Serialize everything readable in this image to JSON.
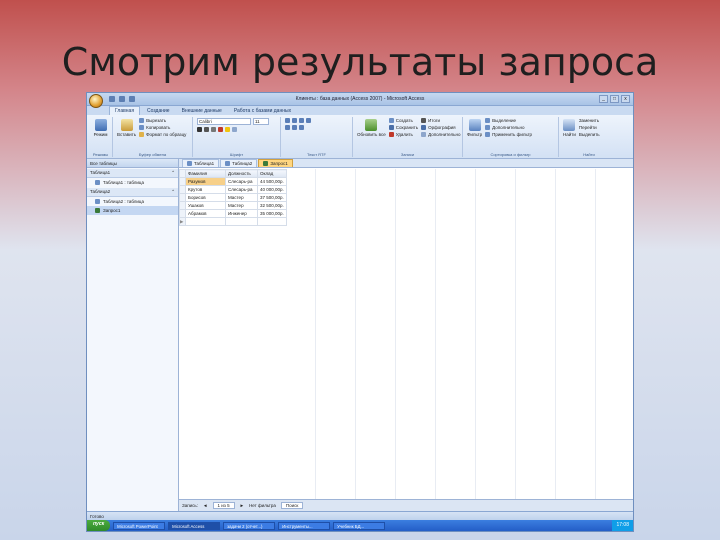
{
  "slide": {
    "title": "Смотрим результаты запроса"
  },
  "window": {
    "title": "Клиенты : база данных (Access 2007) - Microsoft Access",
    "controls": [
      "_",
      "□",
      "x"
    ]
  },
  "ribbon": {
    "tabs": [
      "Главная",
      "Создание",
      "Внешние данные",
      "Работа с базами данных"
    ],
    "active_tab": 0,
    "groups": [
      {
        "caption": "Режимы",
        "items": [
          "Режим"
        ]
      },
      {
        "caption": "Буфер обмена",
        "items": [
          "Вставить",
          "Вырезать",
          "Копировать",
          "Формат по образцу"
        ]
      },
      {
        "caption": "Шрифт",
        "items": [
          "Calibri",
          "11"
        ]
      },
      {
        "caption": "Текст RTF",
        "items": []
      },
      {
        "caption": "Записи",
        "items": [
          "Обновить все",
          "Создать",
          "Сохранить",
          "Удалить",
          "Итоги",
          "Орфография",
          "Дополнительно"
        ]
      },
      {
        "caption": "Сортировка и фильтр",
        "items": [
          "Фильтр",
          "Выделение",
          "Дополнительно",
          "Применить фильтр"
        ]
      },
      {
        "caption": "Найти",
        "items": [
          "Найти",
          "Заменить",
          "Перейти",
          "Выделить"
        ]
      }
    ]
  },
  "nav": {
    "header": "Все таблицы",
    "groups": [
      {
        "name": "Таблица1",
        "items": [
          {
            "label": "Таблица1 : таблица",
            "selected": false
          }
        ]
      },
      {
        "name": "Таблица2",
        "items": [
          {
            "label": "Таблица2 : таблица",
            "selected": false
          },
          {
            "label": "Запрос1",
            "selected": true
          }
        ]
      }
    ]
  },
  "doc_tabs": [
    {
      "label": "Таблица1",
      "active": false
    },
    {
      "label": "Таблица2",
      "active": false
    },
    {
      "label": "Запрос1",
      "active": true
    }
  ],
  "table": {
    "columns": [
      "Фамилия",
      "Должность",
      "Оклад"
    ],
    "rows": [
      [
        "Разумов",
        "Слесарь-ра",
        "44 500,00р."
      ],
      [
        "Крутов",
        "Слесарь-ра",
        "40 000,00р."
      ],
      [
        "Борисов",
        "Мастер",
        "37 500,00р."
      ],
      [
        "Ушаков",
        "Мастер",
        "32 500,00р."
      ],
      [
        "Абрамов",
        "Инженер",
        "35 000,00р."
      ]
    ]
  },
  "record_nav": {
    "label": "Запись:",
    "position": "1 из 5",
    "filter": "Нет фильтра",
    "search": "Поиск"
  },
  "status": {
    "text": "Готово"
  },
  "taskbar": {
    "start": "пуск",
    "items": [
      "Microsoft PowerPoint",
      "Microsoft Access",
      "задачи 2 (отчет...)",
      "Инструменты...",
      "Учебник БД..."
    ],
    "clock": "17:08"
  },
  "colors": {
    "accent": "#c0504d",
    "selection": "#ffd680"
  }
}
